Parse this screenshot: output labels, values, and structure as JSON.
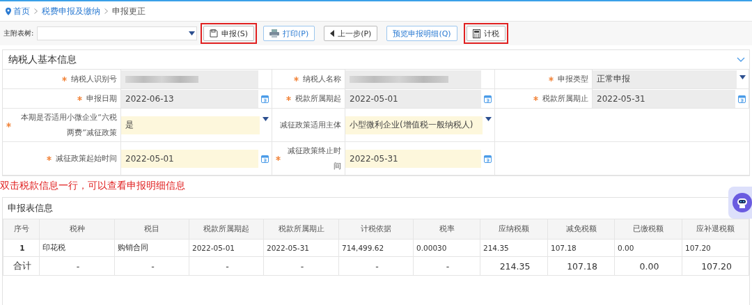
{
  "breadcrumb": [
    {
      "label": "首页",
      "kind": "home"
    },
    {
      "label": "税费申报及缴纳",
      "kind": "link"
    },
    {
      "label": "申报更正",
      "kind": "current"
    }
  ],
  "toolbar": {
    "tree_label": "主附表树:",
    "buttons": [
      {
        "label": "申报(S)",
        "kind": "save",
        "highlighted": true
      },
      {
        "label": "打印(P)",
        "kind": "print",
        "highlighted": false
      },
      {
        "label": "上一步(P)",
        "kind": "back",
        "highlighted": false
      },
      {
        "label": "预览申报明细(Q)",
        "kind": "plain",
        "highlighted": false
      },
      {
        "label": "计税",
        "kind": "calc",
        "highlighted": true
      }
    ]
  },
  "basic_info": {
    "title": "纳税人基本信息",
    "rows": [
      [
        {
          "label": "纳税人识别号",
          "required": true,
          "kind": "blurred",
          "editable": false
        },
        {
          "label": "纳税人名称",
          "required": true,
          "kind": "blurred",
          "editable": false
        },
        {
          "label": "申报类型",
          "required": true,
          "kind": "select",
          "editable": false,
          "value": "正常申报"
        }
      ],
      [
        {
          "label": "申报日期",
          "required": true,
          "kind": "date",
          "editable": false,
          "value": "2022-06-13"
        },
        {
          "label": "税款所属期起",
          "required": true,
          "kind": "date",
          "editable": false,
          "value": "2022-05-01"
        },
        {
          "label": "税款所属期止",
          "required": true,
          "kind": "date",
          "editable": false,
          "value": "2022-05-31"
        }
      ],
      [
        {
          "label": "本期是否适用小微企业“六税两费”减征政策",
          "required": true,
          "kind": "select",
          "editable": true,
          "value": "是"
        },
        {
          "label": "减征政策适用主体",
          "required": false,
          "kind": "select",
          "editable": true,
          "value": "小型微利企业(增值税一般纳税人)"
        }
      ],
      [
        {
          "label": "减征政策起始时间",
          "required": true,
          "kind": "date",
          "editable": true,
          "value": "2022-05-01"
        },
        {
          "label": "减征政策终止时间",
          "required": true,
          "kind": "date",
          "editable": true,
          "value": "2022-05-31"
        }
      ]
    ]
  },
  "note": "双击税款信息一行，可以查看申报明细信息",
  "table": {
    "title": "申报表信息",
    "columns": [
      "序号",
      "税种",
      "税目",
      "税款所属期起",
      "税款所属期止",
      "计税依据",
      "税率",
      "应纳税额",
      "减免税额",
      "已缴税额",
      "应补退税额"
    ],
    "rows": [
      {
        "kind": "item",
        "cells": [
          "1",
          "印花税",
          "购销合同",
          "2022-05-01",
          "2022-05-31",
          "714,499.62",
          "0.00030",
          "214.35",
          "107.18",
          "0.00",
          "107.20"
        ]
      },
      {
        "kind": "total",
        "cells": [
          "合计",
          "-",
          "-",
          "-",
          "-",
          "-",
          "-",
          "214.35",
          "107.18",
          "0.00",
          "107.20"
        ]
      }
    ]
  }
}
